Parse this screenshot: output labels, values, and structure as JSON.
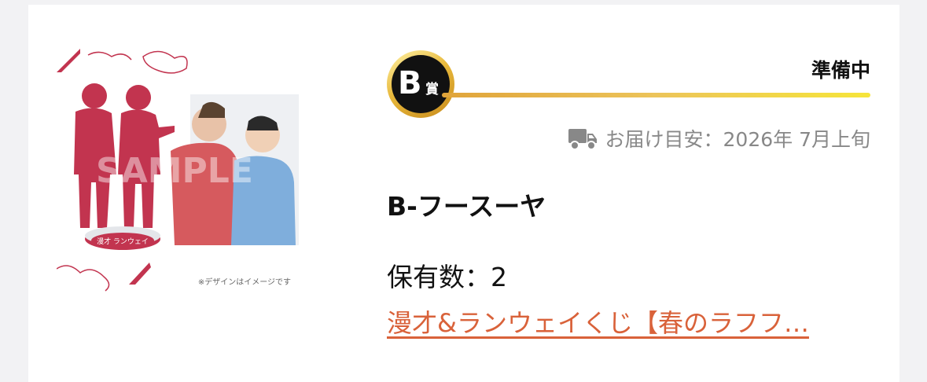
{
  "prize": {
    "rank_letter": "B",
    "rank_suffix": "賞",
    "status": "準備中",
    "delivery_label": "お届け目安：",
    "delivery_date": "2026年 7月上旬",
    "name": "B-フースーヤ",
    "count_label": "保有数：",
    "count_value": "2",
    "lottery_link": "漫才&ランウェイくじ【春のラフフ…"
  },
  "image": {
    "caption": "※デザインはイメージです",
    "watermark": "SAMPLE",
    "stand_text": "漫才 ランウェイ"
  },
  "colors": {
    "accent": "#d9623a",
    "silhouette": "#c2344f",
    "badge_gold": "#e8b93c",
    "rank_line": "#f6e53a",
    "muted": "#888888"
  },
  "icons": {
    "badge": "rank-badge-icon",
    "delivery": "truck-icon"
  }
}
